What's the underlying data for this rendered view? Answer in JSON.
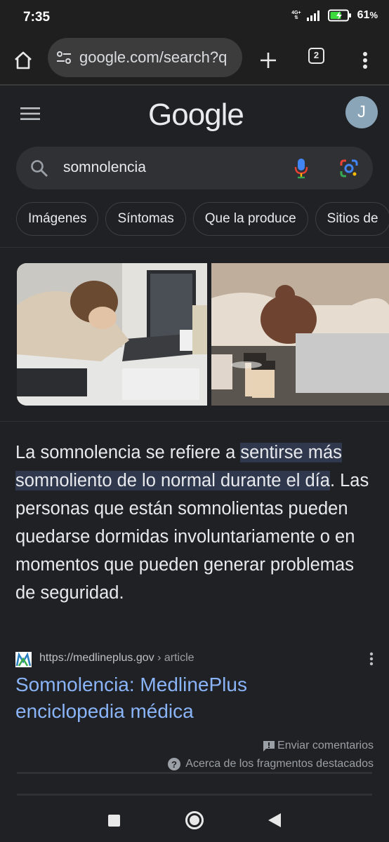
{
  "status_bar": {
    "time": "7:35",
    "network": "4G+",
    "battery": "61"
  },
  "browser": {
    "url": "google.com/search?q",
    "tab_count": "2"
  },
  "google": {
    "logo": "Google",
    "avatar_letter": "J"
  },
  "search": {
    "query": "somnolencia"
  },
  "chips": [
    "Imágenes",
    "Síntomas",
    "Que la produce",
    "Sitios de"
  ],
  "featured_snippet": {
    "text_before": "La somnolencia se refiere a ",
    "highlight": "sentirse más somnoliento de lo normal durante el día",
    "text_after": ". Las personas que están somnolientas pueden quedarse dormidas involuntariamente o en momentos que pueden generar problemas de seguridad.",
    "source_url": "https://medlineplus.gov",
    "source_crumb": " › article",
    "title": "Somnolencia: MedlinePlus enciclopedia médica",
    "feedback_label": "Enviar comentarios",
    "about_label": "Acerca de los fragmentos destacados"
  },
  "colors": {
    "background": "#202124",
    "link": "#8ab4f8",
    "highlight": "#30384d"
  }
}
